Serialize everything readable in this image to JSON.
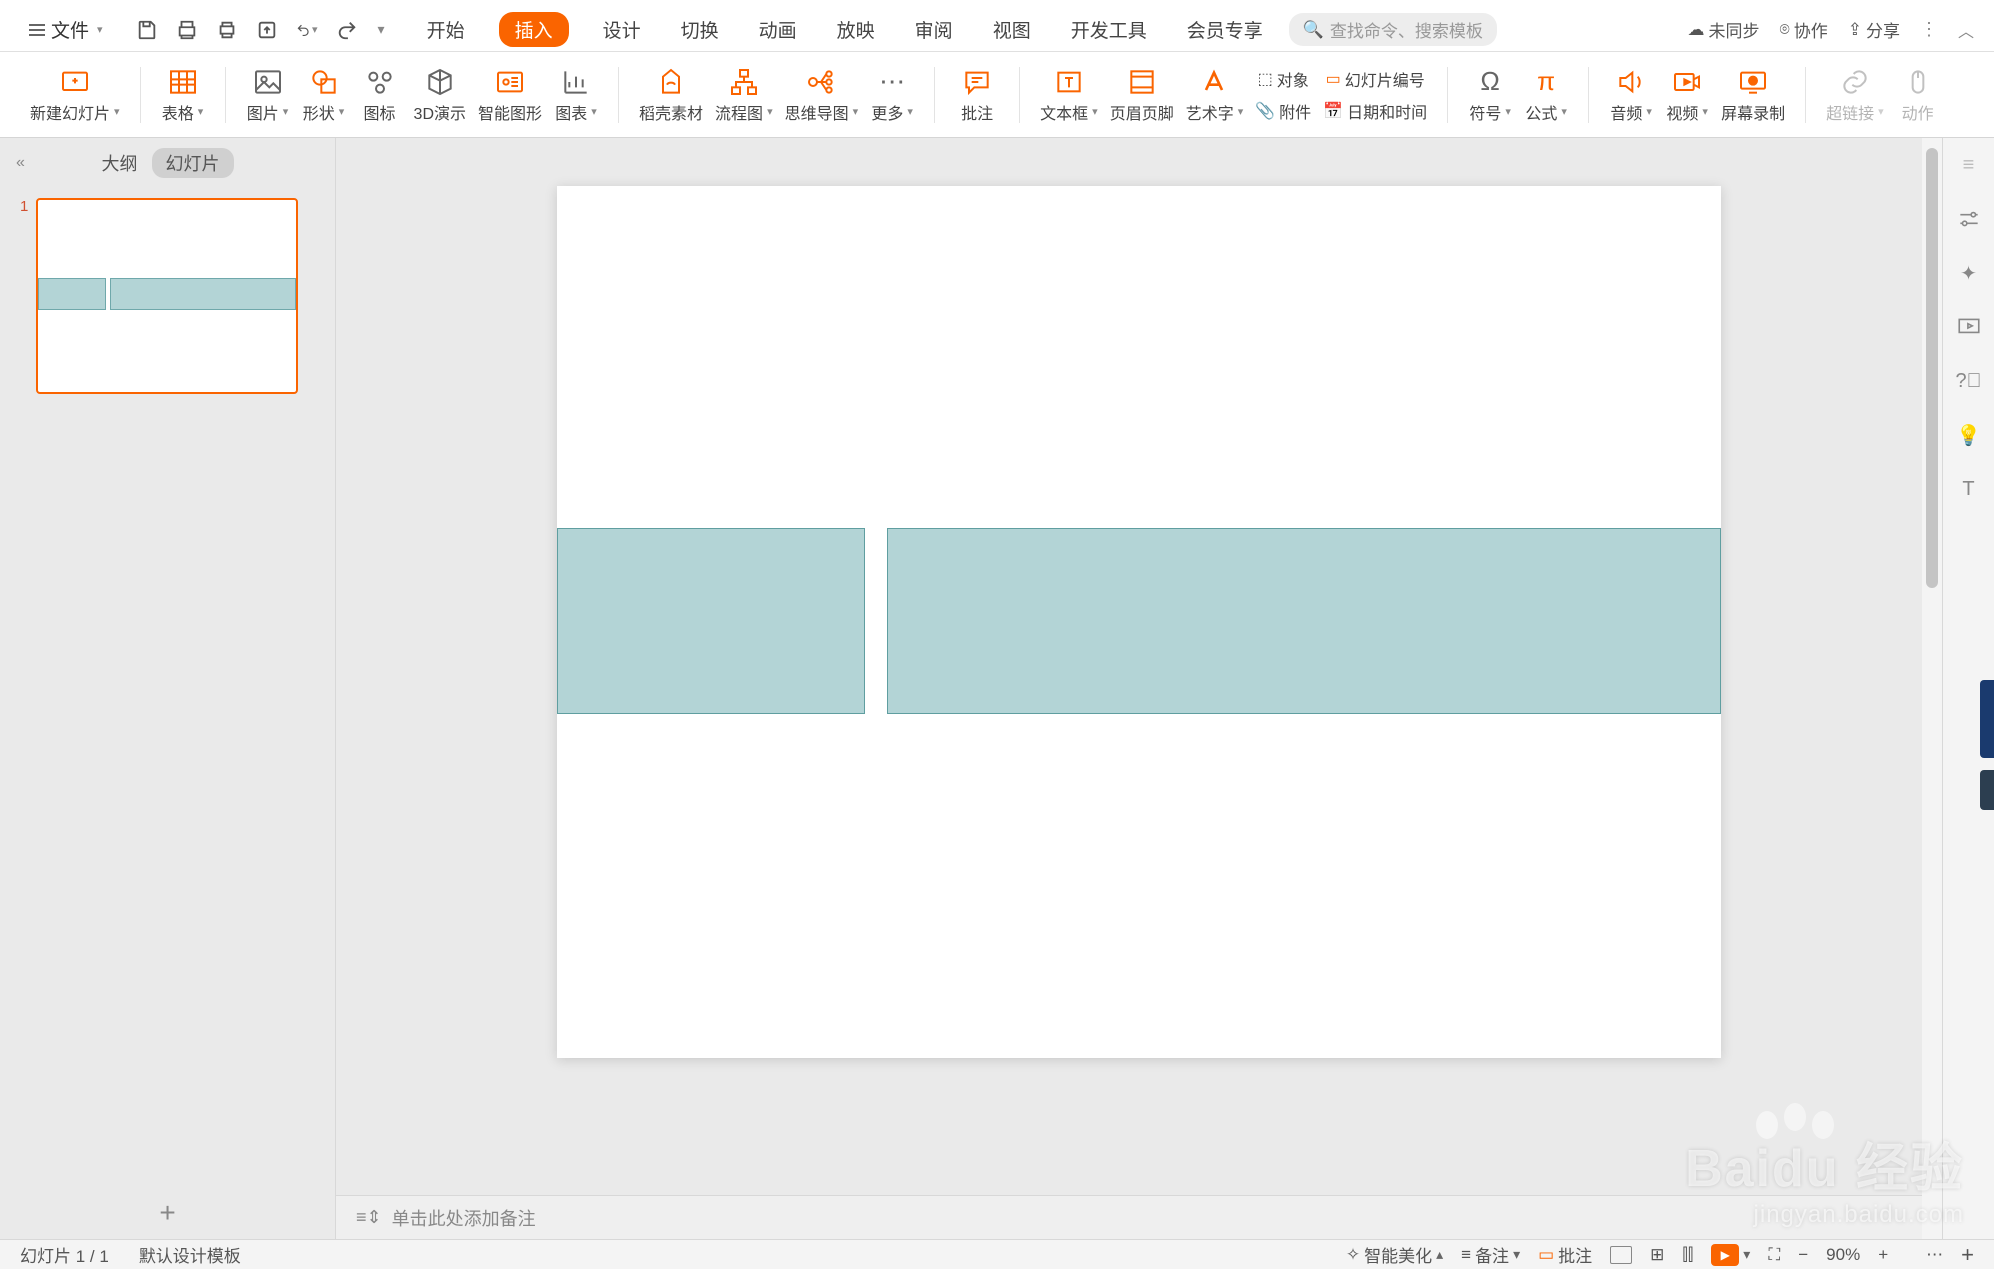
{
  "menubar": {
    "file": "文件",
    "tabs": [
      "开始",
      "插入",
      "设计",
      "切换",
      "动画",
      "放映",
      "审阅",
      "视图",
      "开发工具",
      "会员专享"
    ],
    "active_tab_index": 1,
    "search_placeholder": "查找命令、搜索模板",
    "sync": "未同步",
    "collab": "协作",
    "share": "分享"
  },
  "ribbon": {
    "new_slide": "新建幻灯片",
    "table": "表格",
    "picture": "图片",
    "shape": "形状",
    "icon": "图标",
    "threeD": "3D演示",
    "smartart": "智能图形",
    "chart": "图表",
    "docer": "稻壳素材",
    "flowchart": "流程图",
    "mindmap": "思维导图",
    "more": "更多",
    "comment": "批注",
    "textbox": "文本框",
    "headerfooter": "页眉页脚",
    "wordart": "艺术字",
    "object": "对象",
    "attach": "附件",
    "slidenum": "幻灯片编号",
    "datetime": "日期和时间",
    "symbol": "符号",
    "equation": "公式",
    "audio": "音频",
    "video": "视频",
    "screenrec": "屏幕录制",
    "hyperlink": "超链接",
    "action": "动作"
  },
  "left_panel": {
    "outline": "大纲",
    "slides": "幻灯片",
    "slide_number": "1"
  },
  "notes": {
    "placeholder": "单击此处添加备注"
  },
  "statusbar": {
    "slide_info": "幻灯片 1 / 1",
    "template": "默认设计模板",
    "beautify": "智能美化",
    "notes": "备注",
    "comments": "批注",
    "zoom": "90%"
  },
  "side_dots": "⋯",
  "watermark": {
    "logo": "Baidu 经验",
    "url": "jingyan.baidu.com"
  }
}
